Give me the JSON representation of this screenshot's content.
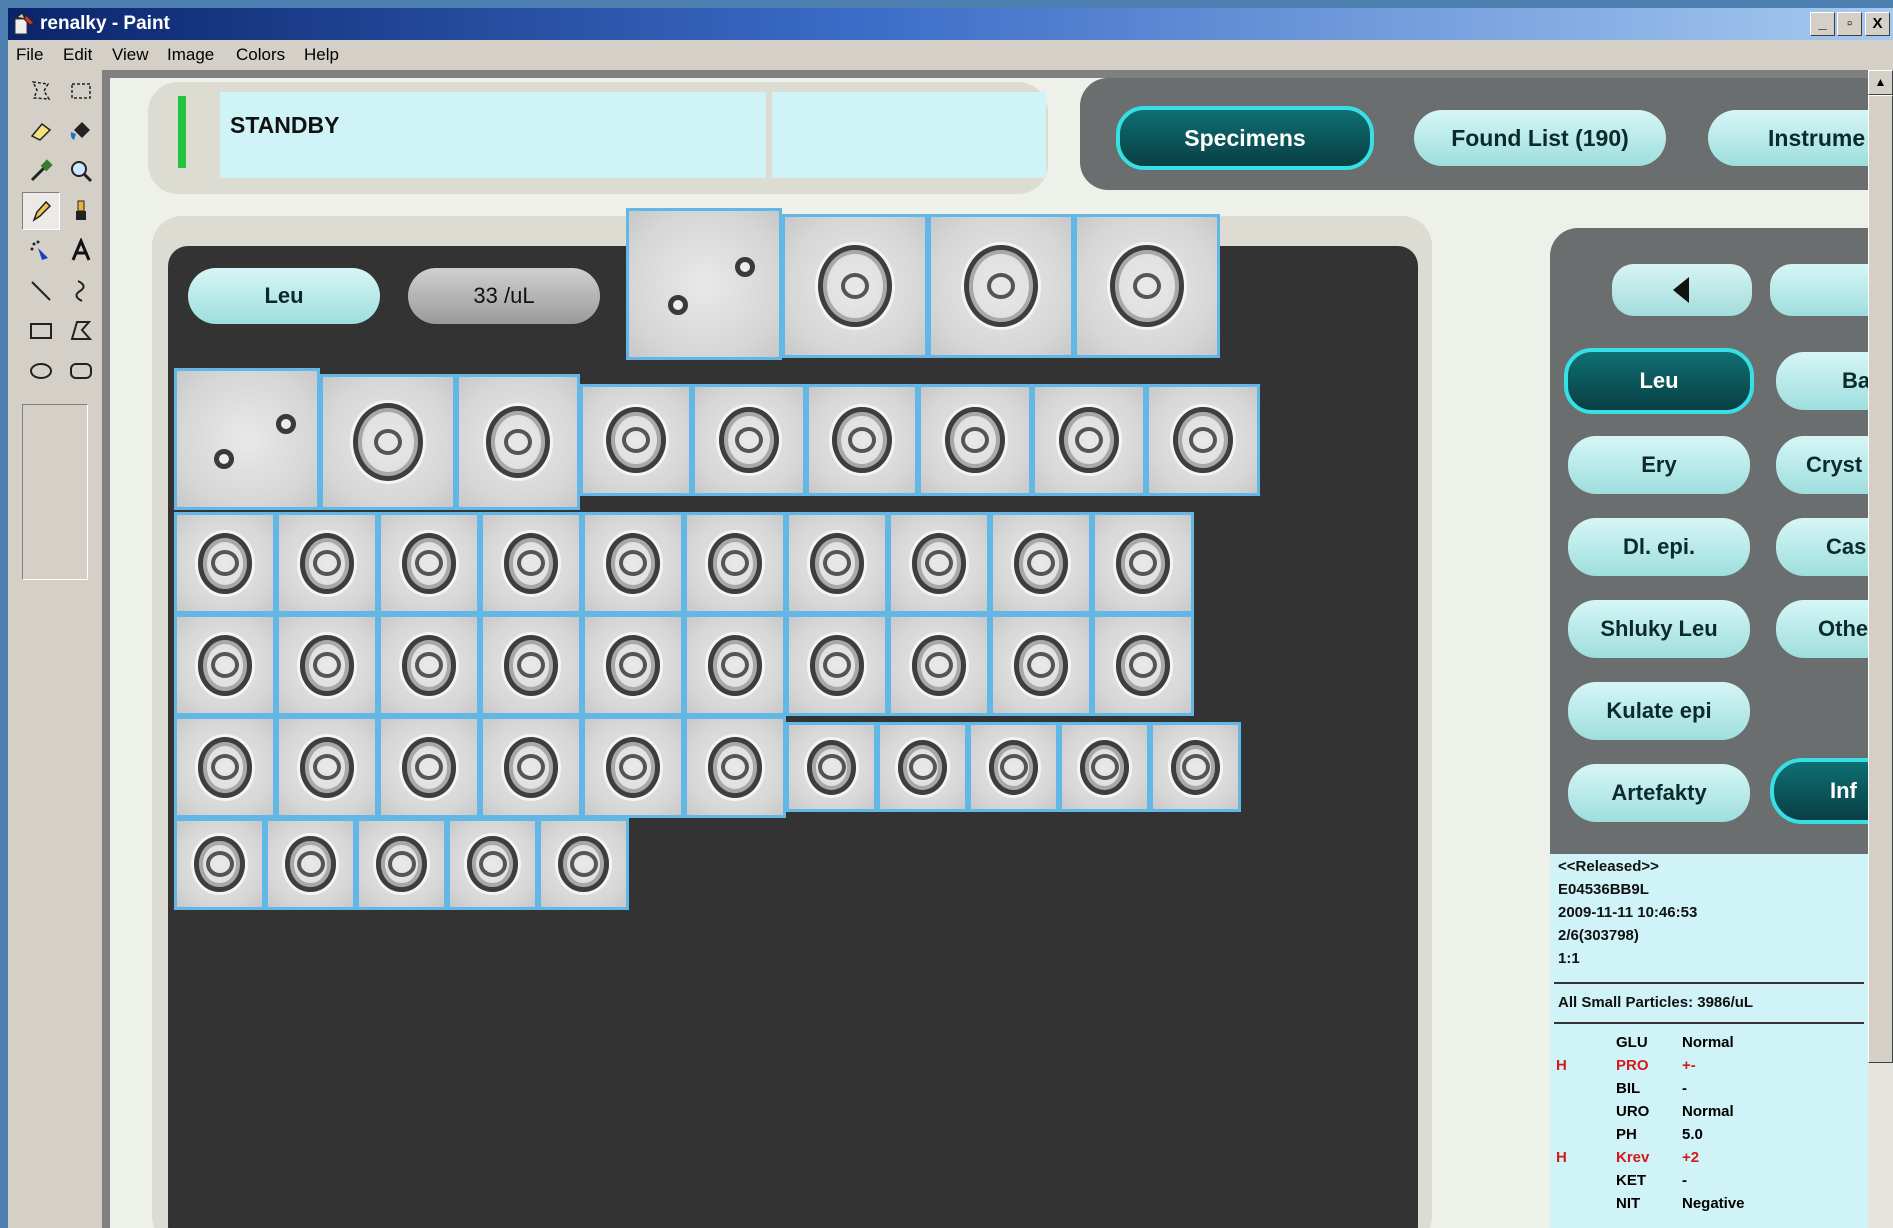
{
  "window": {
    "title": "renalky - Paint",
    "controls": [
      "_",
      "▫",
      "X"
    ]
  },
  "menu": [
    "File",
    "Edit",
    "View",
    "Image",
    "Colors",
    "Help"
  ],
  "tools": [
    {
      "name": "free-select-icon",
      "glyph": "⬚"
    },
    {
      "name": "rect-select-icon",
      "glyph": "⬚"
    },
    {
      "name": "eraser-icon",
      "glyph": "▱"
    },
    {
      "name": "fill-icon",
      "glyph": "◆"
    },
    {
      "name": "color-picker-icon",
      "glyph": "✎"
    },
    {
      "name": "magnifier-icon",
      "glyph": "⌕"
    },
    {
      "name": "pencil-icon",
      "glyph": "✏"
    },
    {
      "name": "brush-icon",
      "glyph": "♙"
    },
    {
      "name": "airbrush-icon",
      "glyph": "✾"
    },
    {
      "name": "text-icon",
      "glyph": "A"
    },
    {
      "name": "line-icon",
      "glyph": "╲"
    },
    {
      "name": "curve-icon",
      "glyph": "ʃ"
    },
    {
      "name": "rectangle-icon",
      "glyph": "▭"
    },
    {
      "name": "polygon-icon",
      "glyph": "⏢"
    },
    {
      "name": "ellipse-icon",
      "glyph": "⬭"
    },
    {
      "name": "rounded-rect-icon",
      "glyph": "▢"
    }
  ],
  "app": {
    "status": "STANDBY",
    "tabs": {
      "specimens": "Specimens",
      "found_list": "Found List (190)",
      "instrument": "Instrume"
    },
    "category": {
      "label": "Leu",
      "value": "33 /uL"
    },
    "side_buttons": {
      "leu": "Leu",
      "ba": "Ba",
      "ery": "Ery",
      "cryst": "Cryst",
      "dl_epi": "Dl. epi.",
      "cas": "Cas",
      "shluky_leu": "Shluky Leu",
      "othe": "Othe",
      "kulate_epi": "Kulate epi",
      "artefakty": "Artefakty",
      "inf": "Inf"
    },
    "info": {
      "released": "<<Released>>",
      "id": "E04536BB9L",
      "datetime": "2009-11-11 10:46:53",
      "rack": "2/6(303798)",
      "ratio": "1:1",
      "small_particles": "All Small Particles: 3986/uL"
    },
    "chemistry": [
      {
        "flag": "",
        "name": "GLU",
        "value": "Normal"
      },
      {
        "flag": "H",
        "name": "PRO",
        "value": "+-"
      },
      {
        "flag": "",
        "name": "BIL",
        "value": "-"
      },
      {
        "flag": "",
        "name": "URO",
        "value": "Normal"
      },
      {
        "flag": "",
        "name": "PH",
        "value": "5.0"
      },
      {
        "flag": "H",
        "name": "Krev",
        "value": "+2"
      },
      {
        "flag": "",
        "name": "KET",
        "value": "-"
      },
      {
        "flag": "",
        "name": "NIT",
        "value": "Negative"
      }
    ]
  },
  "colors": {
    "accent_teal": "#36e0e4",
    "thumb_border": "#62b7e6",
    "flag_red": "#d41a1a",
    "status_green": "#23c43c"
  }
}
